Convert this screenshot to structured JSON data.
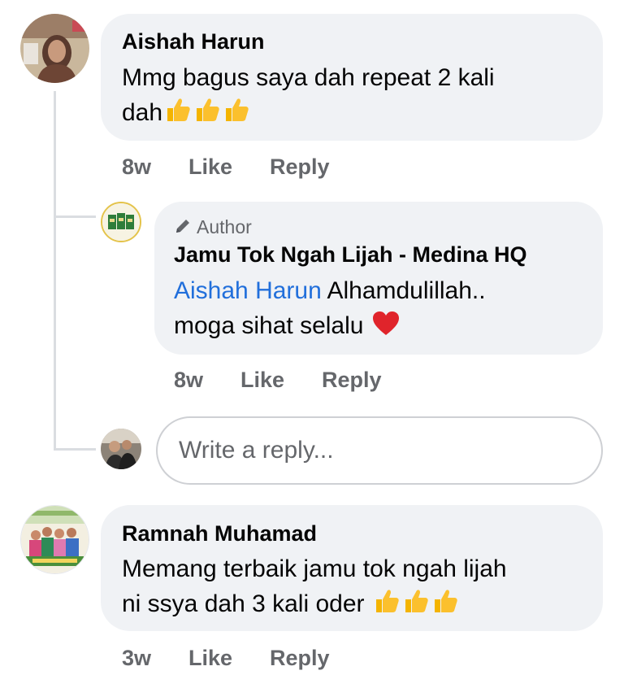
{
  "comments": [
    {
      "author": "Aishah Harun",
      "text_line1": "Mmg bagus  saya dah repeat  2 kali",
      "text_line2": "dah",
      "emoji": [
        "thumbs-up",
        "thumbs-up",
        "thumbs-up"
      ],
      "time": "8w",
      "like_label": "Like",
      "reply_label": "Reply"
    },
    {
      "author": "Ramnah Muhamad",
      "text_line1": "Memang terbaik jamu tok ngah lijah",
      "text_line2": "ni ssya dah 3 kali oder ",
      "emoji": [
        "thumbs-up",
        "thumbs-up",
        "thumbs-up"
      ],
      "time": "3w",
      "like_label": "Like",
      "reply_label": "Reply"
    }
  ],
  "reply": {
    "badge": "Author",
    "badge_icon": "pencil-icon",
    "author": "Jamu Tok Ngah Lijah - Medina HQ",
    "mention": "Aishah Harun",
    "text_line1": " Alhamdulillah..",
    "text_line2": "moga sihat selalu ",
    "emoji": "red-heart",
    "time": "8w",
    "like_label": "Like",
    "reply_label": "Reply"
  },
  "reply_box": {
    "placeholder": "Write a reply..."
  },
  "colors": {
    "bubble": "#f0f2f5",
    "meta_text": "#65676b",
    "mention": "#216fdb",
    "thread_line": "#dadde1"
  }
}
